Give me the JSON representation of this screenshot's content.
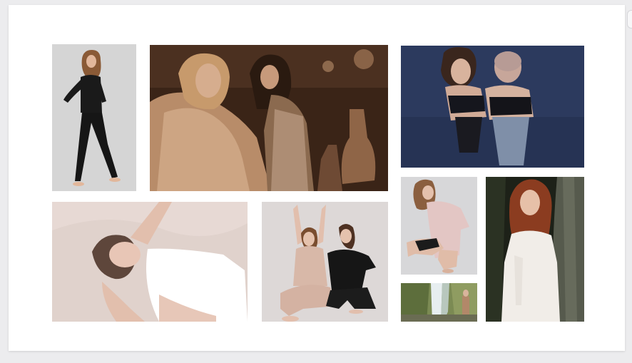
{
  "gallery": {
    "photos": [
      {
        "subject": "standing-woman-black-outfit",
        "palette": [
          "#d5d5d5",
          "#1a1a1a"
        ]
      },
      {
        "subject": "two-women-fur-coat-bar",
        "palette": [
          "#3a2417",
          "#c49a73"
        ]
      },
      {
        "subject": "two-women-looking-up-blue-floor",
        "palette": [
          "#2c3a5e",
          "#d9b9a6"
        ]
      },
      {
        "subject": "woman-lying-on-sand",
        "palette": [
          "#e7d9d4",
          "#ffffff"
        ]
      },
      {
        "subject": "two-women-seated-stretching",
        "palette": [
          "#ddd8d7",
          "#d8b8a8"
        ]
      },
      {
        "subject": "woman-crouching-pink-shirt",
        "palette": [
          "#d7d7d9",
          "#e3c6c4"
        ]
      },
      {
        "subject": "waterfall-landscape",
        "palette": [
          "#7b8a53",
          "#e7eef0"
        ]
      },
      {
        "subject": "redhead-woman-in-forest",
        "palette": [
          "#1d2118",
          "#f1ede8"
        ]
      }
    ]
  }
}
